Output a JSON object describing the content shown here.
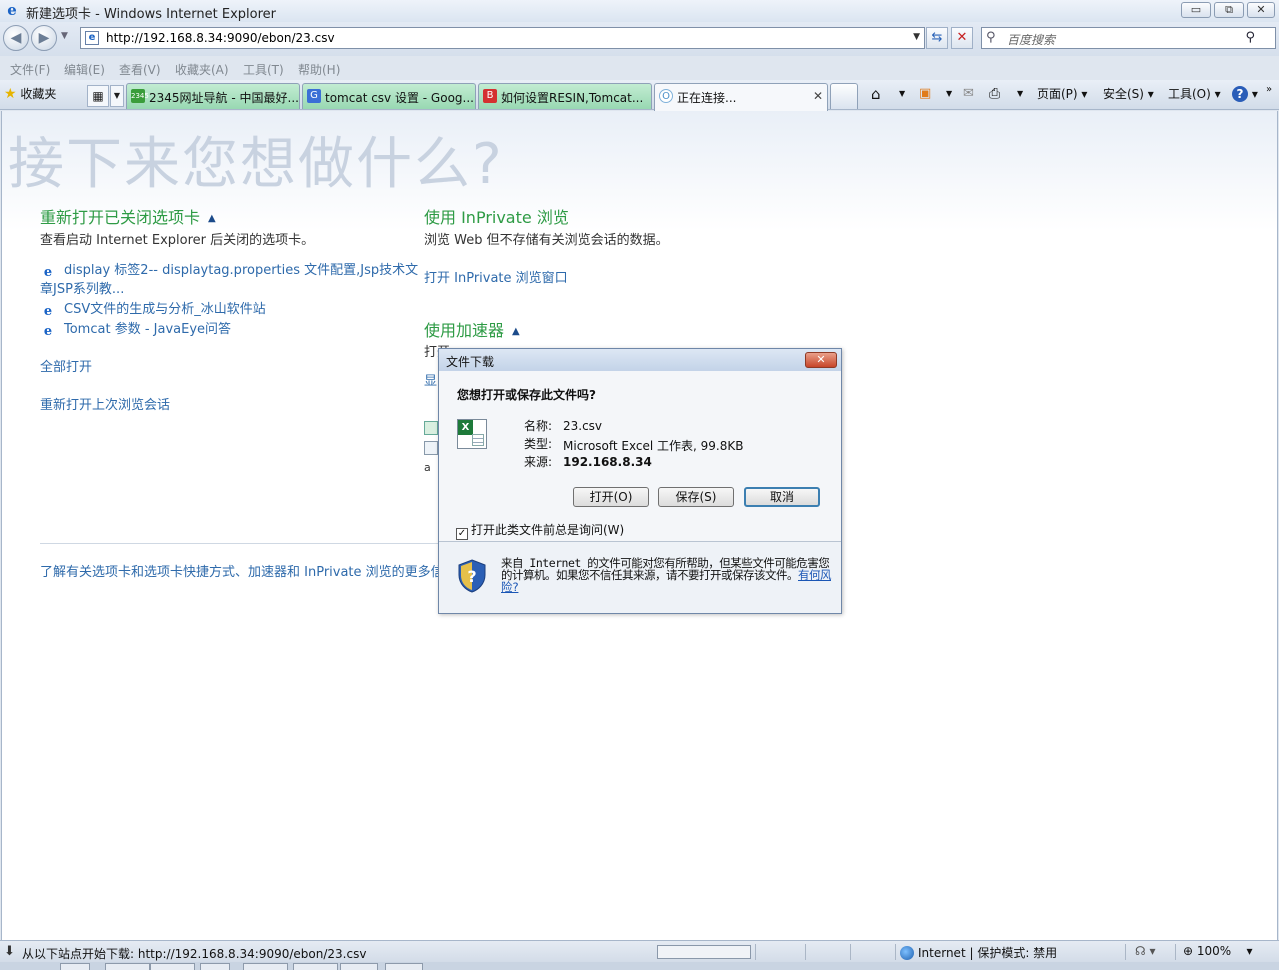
{
  "window": {
    "title": "新建选项卡 - Windows Internet Explorer",
    "buttons": {
      "minimize": "▭",
      "restore": "⧉",
      "close": "✕"
    }
  },
  "address": {
    "url": "http://192.168.8.34:9090/ebon/23.csv",
    "refresh": "⇆",
    "stop": "✕"
  },
  "search": {
    "placeholder": "百度搜索",
    "go": "⚲"
  },
  "menu": [
    "文件(F)",
    "编辑(E)",
    "查看(V)",
    "收藏夹(A)",
    "工具(T)",
    "帮助(H)"
  ],
  "favorites": {
    "label": "收藏夹"
  },
  "tabs": [
    {
      "label": "2345网址导航 - 中国最好...",
      "icon": "2345"
    },
    {
      "label": "tomcat csv 设置 - Goog...",
      "icon": "G"
    },
    {
      "label": "如何设置RESIN,Tomcat...",
      "icon": "B"
    },
    {
      "label": "正在连接...",
      "icon": "O"
    }
  ],
  "toolbar": {
    "page": "页面(P)",
    "safety": "安全(S)",
    "tools": "工具(O)",
    "help": "?"
  },
  "newtab": {
    "heading": "接下来您想做什么?",
    "reopen": {
      "title": "重新打开已关闭选项卡",
      "desc": "查看启动 Internet Explorer 后关闭的选项卡。",
      "links": [
        "display 标签2-- displaytag.properties 文件配置,Jsp技术文",
        "章JSP系列教...",
        "CSV文件的生成与分析_冰山软件站",
        "Tomcat 参数 - JavaEye问答"
      ],
      "open_all": "全部打开",
      "reopen_session": "重新打开上次浏览会话"
    },
    "inprivate": {
      "title": "使用 InPrivate 浏览",
      "desc": "浏览 Web 但不存储有关浏览会话的数据。",
      "link": "打开 InPrivate 浏览窗口"
    },
    "accelerators": {
      "title": "使用加速器",
      "desc_partial": "打开",
      "link_partial": "显"
    },
    "footer": "了解有关选项卡和选项卡快捷方式、加速器和 InPrivate 浏览的更多信"
  },
  "dialog": {
    "title": "文件下载",
    "question": "您想打开或保存此文件吗?",
    "name_label": "名称:",
    "name_value": "23.csv",
    "type_label": "类型:",
    "type_value": "Microsoft Excel 工作表, 99.8KB",
    "source_label": "来源:",
    "source_value": "192.168.8.34",
    "open": "打开(O)",
    "save": "保存(S)",
    "cancel": "取消",
    "always_ask": "打开此类文件前总是询问(W)",
    "warning": "来自 Internet 的文件可能对您有所帮助，但某些文件可能危害您的计算机。如果您不信任其来源，请不要打开或保存该文件。",
    "risk_link": "有何风险?"
  },
  "status": {
    "text": "从以下站点开始下载: http://192.168.8.34:9090/ebon/23.csv",
    "zone": "Internet | 保护模式: 禁用",
    "zoom": "100%"
  }
}
